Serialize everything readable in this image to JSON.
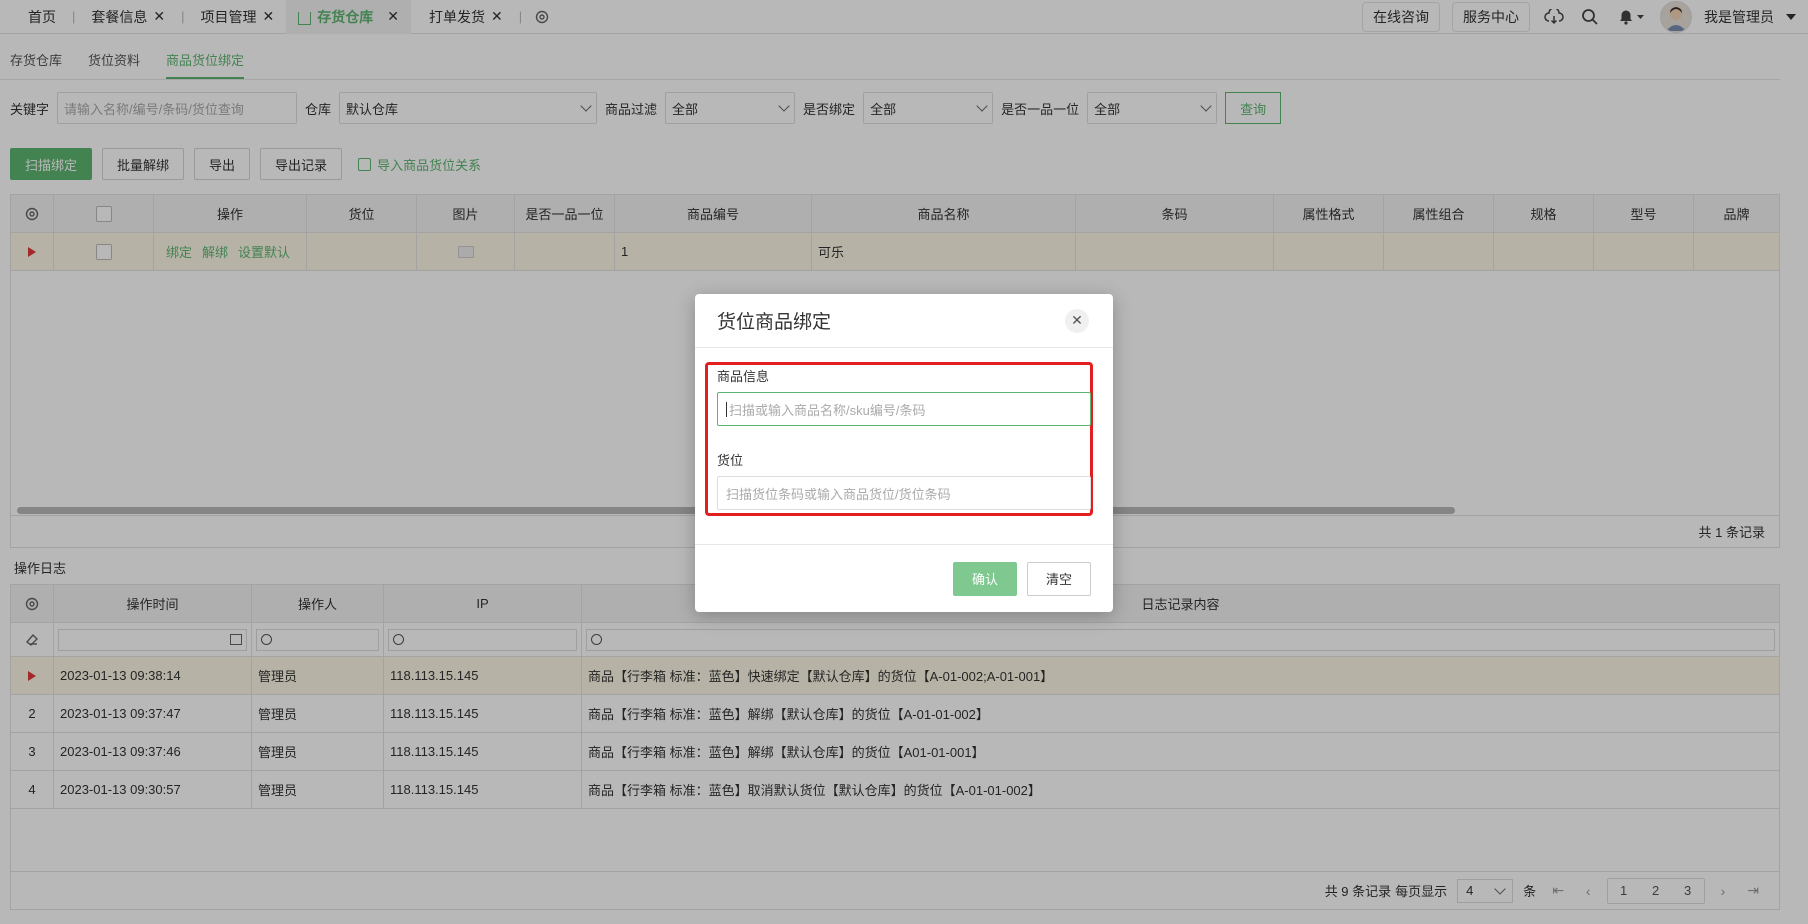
{
  "topbar": {
    "tabs": [
      {
        "label": "首页",
        "closable": false,
        "active": false
      },
      {
        "label": "套餐信息",
        "closable": true,
        "active": false
      },
      {
        "label": "项目管理",
        "closable": true,
        "active": false
      },
      {
        "label": "存货仓库",
        "closable": true,
        "active": true
      },
      {
        "label": "打单发货",
        "closable": true,
        "active": false
      }
    ],
    "online_consult": "在线咨询",
    "service_center": "服务中心",
    "user_name": "我是管理员"
  },
  "subtabs": [
    {
      "label": "存货仓库",
      "active": false
    },
    {
      "label": "货位资料",
      "active": false
    },
    {
      "label": "商品货位绑定",
      "active": true
    }
  ],
  "filters": {
    "keyword_label": "关键字",
    "keyword_placeholder": "请输入名称/编号/条码/货位查询",
    "warehouse_label": "仓库",
    "warehouse_value": "默认仓库",
    "goods_filter_label": "商品过滤",
    "goods_filter_value": "全部",
    "bound_label": "是否绑定",
    "bound_value": "全部",
    "one_item_label": "是否一品一位",
    "one_item_value": "全部",
    "query_label": "查询"
  },
  "actions": {
    "scan_bind": "扫描绑定",
    "batch_unbind": "批量解绑",
    "export": "导出",
    "export_records": "导出记录",
    "import_relation": "导入商品货位关系"
  },
  "table": {
    "headers": [
      "操作",
      "货位",
      "图片",
      "是否一品一位",
      "商品编号",
      "商品名称",
      "条码",
      "属性格式",
      "属性组合",
      "规格",
      "型号",
      "品牌"
    ],
    "row": {
      "ops": [
        "绑定",
        "解绑",
        "设置默认"
      ],
      "location": "",
      "one_item": "",
      "code": "1",
      "name": "可乐",
      "barcode": ""
    },
    "total": "共 1 条记录"
  },
  "log": {
    "title": "操作日志",
    "headers": [
      "操作时间",
      "操作人",
      "IP",
      "日志记录内容"
    ],
    "rows": [
      {
        "no": "",
        "time": "2023-01-13 09:38:14",
        "user": "管理员",
        "ip": "118.113.15.145",
        "content": "商品【行李箱 标准：蓝色】快速绑定【默认仓库】的货位【A-01-002;A-01-001】"
      },
      {
        "no": "2",
        "time": "2023-01-13 09:37:47",
        "user": "管理员",
        "ip": "118.113.15.145",
        "content": "商品【行李箱 标准：蓝色】解绑【默认仓库】的货位【A-01-01-002】"
      },
      {
        "no": "3",
        "time": "2023-01-13 09:37:46",
        "user": "管理员",
        "ip": "118.113.15.145",
        "content": "商品【行李箱 标准：蓝色】解绑【默认仓库】的货位【A01-01-001】"
      },
      {
        "no": "4",
        "time": "2023-01-13 09:30:57",
        "user": "管理员",
        "ip": "118.113.15.145",
        "content": "商品【行李箱 标准：蓝色】取消默认货位【默认仓库】的货位【A-01-01-002】"
      }
    ],
    "footer": {
      "total": "共 9 条记录",
      "per_page_label": "每页显示",
      "per_page_value": "4",
      "unit": "条",
      "pages": [
        "1",
        "2",
        "3"
      ]
    }
  },
  "modal": {
    "title": "货位商品绑定",
    "goods_label": "商品信息",
    "goods_placeholder": "扫描或输入商品名称/sku编号/条码",
    "location_label": "货位",
    "location_placeholder": "扫描货位条码或输入商品货位/货位条码",
    "confirm": "确认",
    "clear": "清空"
  },
  "colors": {
    "accent": "#5db571",
    "highlight": "#e21e1e"
  }
}
